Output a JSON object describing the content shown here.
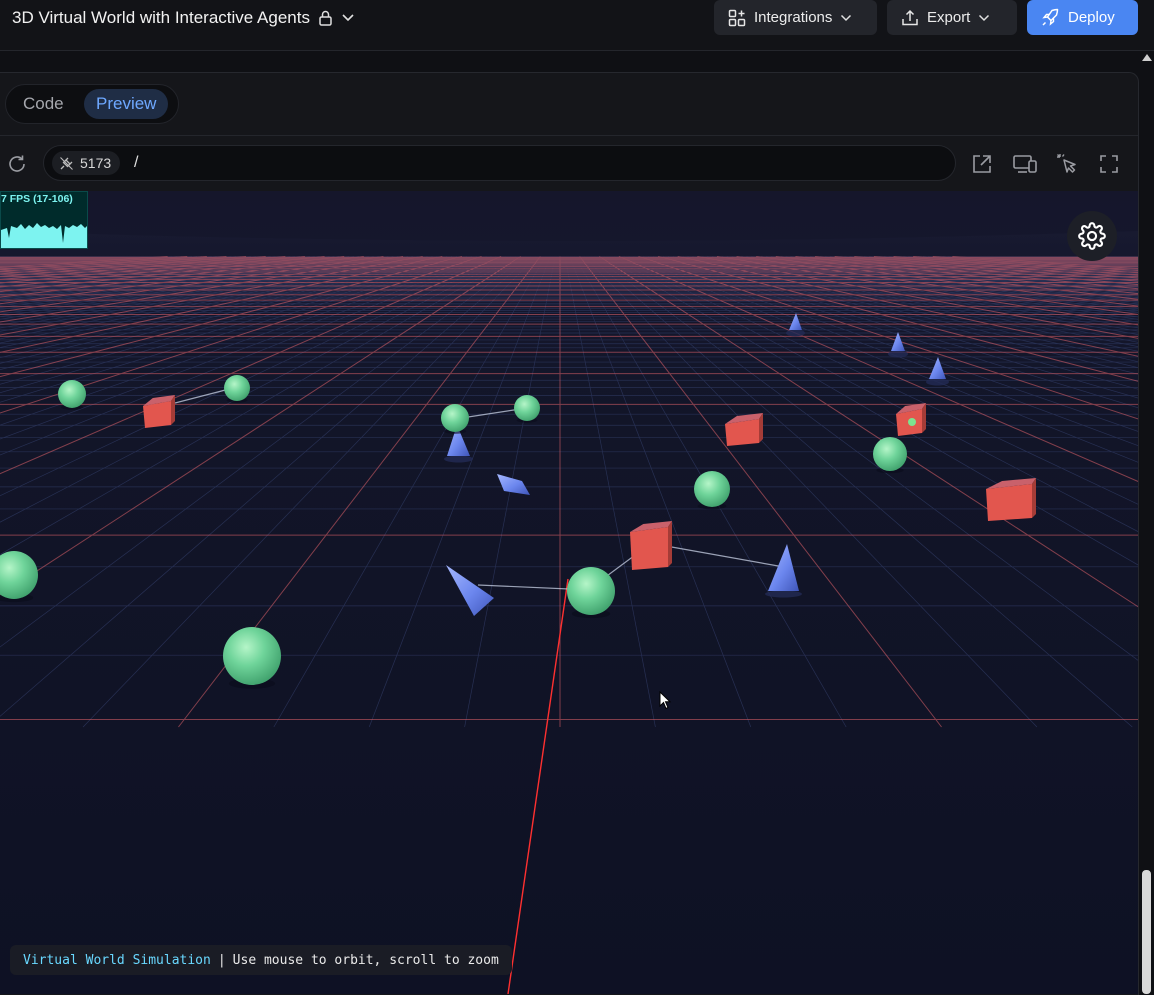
{
  "header": {
    "project_title": "3D Virtual World with Interactive Agents",
    "integrations_label": "Integrations",
    "export_label": "Export",
    "deploy_label": "Deploy"
  },
  "tabs": {
    "code_label": "Code",
    "preview_label": "Preview",
    "active": "Preview"
  },
  "address_bar": {
    "port": "5173",
    "path": "/"
  },
  "scene": {
    "fps_text": "7 FPS (17-106)",
    "hint_accent": "Virtual World Simulation",
    "hint_separator": "|",
    "hint_text": "Use mouse to orbit, scroll to zoom"
  },
  "colors": {
    "accent": "#4a86f2",
    "grid_line": "#e0626a",
    "sphere": "#6fd49a",
    "cube": "#e2564e",
    "cone": "#6b86ee"
  },
  "icons": [
    "lock-icon",
    "chevron-down-icon",
    "integrations-grid-icon",
    "export-icon",
    "rocket-icon",
    "reload-icon",
    "plug-icon",
    "open-external-icon",
    "devices-icon",
    "pointer-select-icon",
    "fullscreen-icon",
    "gear-icon"
  ]
}
